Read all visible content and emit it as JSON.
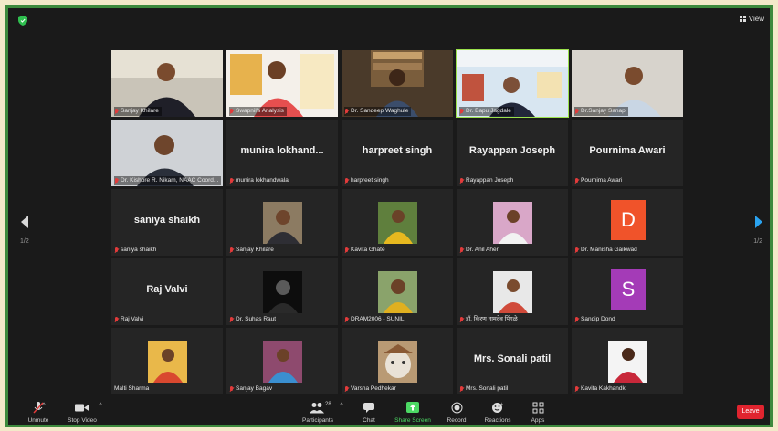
{
  "window": {
    "view_label": "View"
  },
  "pagination": {
    "left": "1/2",
    "right": "1/2"
  },
  "participants_row1": [
    {
      "name": "Sanjay Khilare"
    },
    {
      "name": "Swapnil's Analysis"
    },
    {
      "name": "Dr. Sandeep Waghule"
    },
    {
      "name": "Dr. Bapu Jagdale"
    },
    {
      "name": "Dr.Sanjay Sanap"
    }
  ],
  "tiles_row2": [
    {
      "name": "Dr. Kishore R. Nikam, NAAC Coord..."
    },
    {
      "big": "munira lokhand...",
      "name": "munira lokhandwala"
    },
    {
      "big": "harpreet singh",
      "name": "harpreet singh"
    },
    {
      "big": "Rayappan Joseph",
      "name": "Rayappan Joseph"
    },
    {
      "big": "Pournima Awari",
      "name": "Pournima Awari"
    }
  ],
  "tiles_row3": [
    {
      "big": "saniya shaikh",
      "name": "saniya shaikh"
    },
    {
      "name": "Sanjay Khilare"
    },
    {
      "name": "Kavita Ghate"
    },
    {
      "name": "Dr. Anil Aher"
    },
    {
      "letter": "D",
      "name": "Dr. Manisha Gaikwad",
      "color": "#f0532a"
    }
  ],
  "tiles_row4": [
    {
      "big": "Raj Valvi",
      "name": "Raj Valvi"
    },
    {
      "name": "Dr. Suhas Raut"
    },
    {
      "name": "DRAM2006 - SUNIL"
    },
    {
      "name": "डॉ. किरण नामदेव पिंगळे"
    },
    {
      "letter": "S",
      "name": "Sandip Dond",
      "color": "#a43bb7"
    }
  ],
  "tiles_row5": [
    {
      "name": "Malti Sharma"
    },
    {
      "name": "Sanjay Bagav"
    },
    {
      "name": "Varsha Pedhekar"
    },
    {
      "big": "Mrs. Sonali patil",
      "name": "Mrs. Sonali patil"
    },
    {
      "name": "Kavita Kakhandki"
    }
  ],
  "toolbar": {
    "unmute": "Unmute",
    "stop_video": "Stop Video",
    "participants": "Participants",
    "participants_count": "28",
    "chat": "Chat",
    "share_screen": "Share Screen",
    "record": "Record",
    "reactions": "Reactions",
    "apps": "Apps",
    "leave": "Leave"
  },
  "colors": {
    "accent_green": "#4cd964",
    "active_border": "#9be14c",
    "leave_red": "#e0242f"
  }
}
